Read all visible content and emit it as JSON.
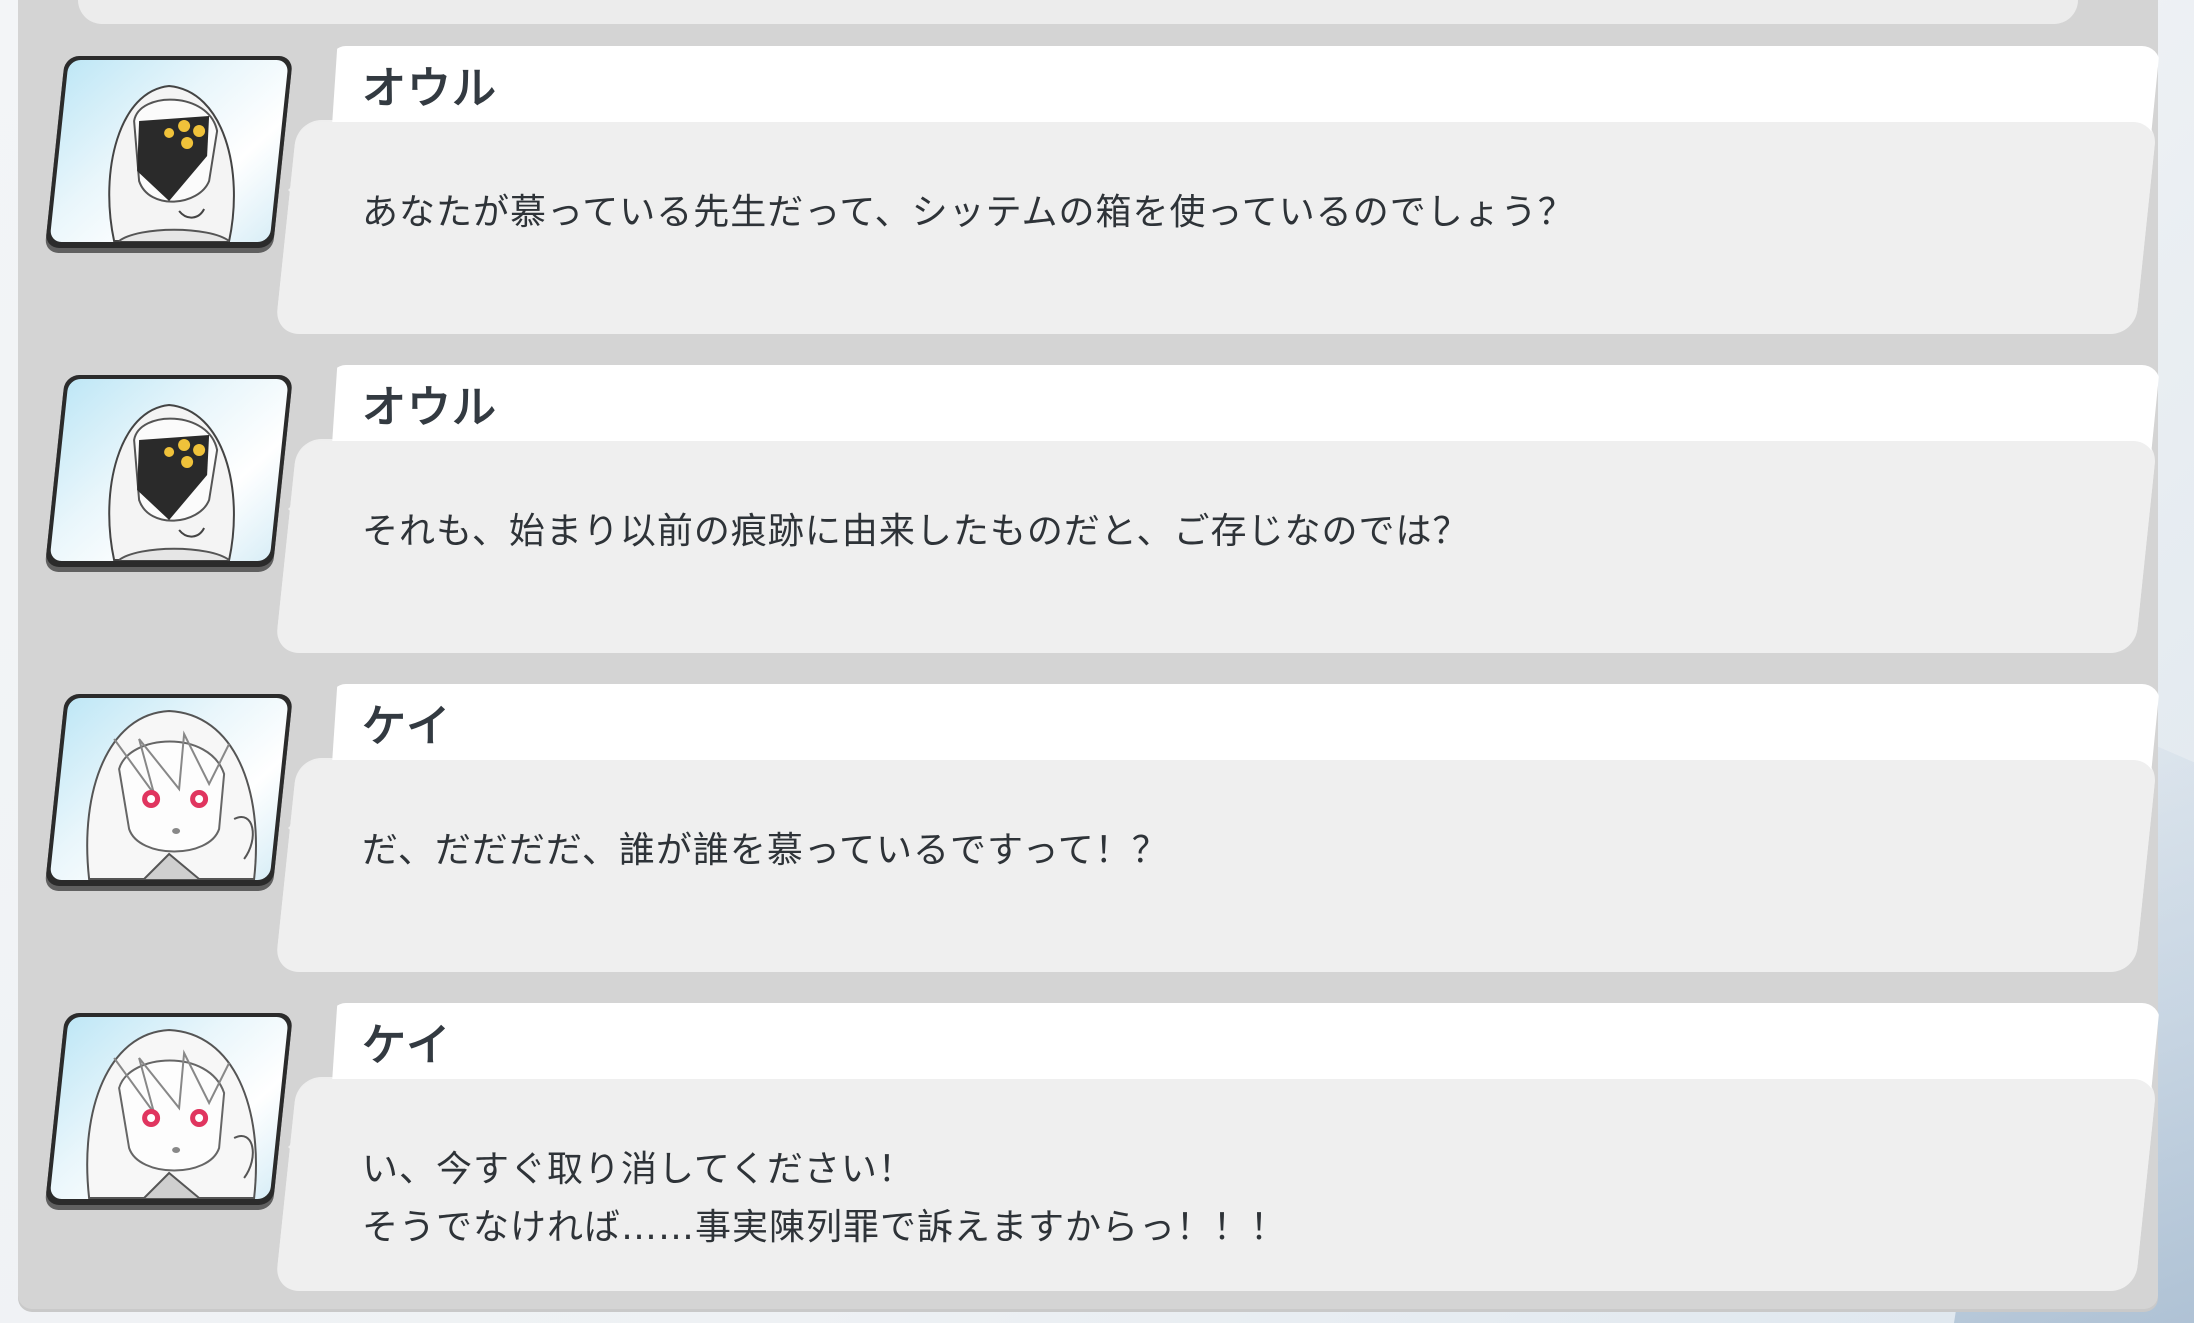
{
  "messages": [
    {
      "speaker": "オウル",
      "avatar": "owl-portrait-icon",
      "text": "あなたが慕っている先生だって、シッテムの箱を使っているのでしょう？"
    },
    {
      "speaker": "オウル",
      "avatar": "owl-portrait-icon",
      "text": "それも、始まり以前の痕跡に由来したものだと、ご存じなのでは？"
    },
    {
      "speaker": "ケイ",
      "avatar": "kei-portrait-icon",
      "text": "だ、だだだだ、誰が誰を慕っているですって！？"
    },
    {
      "speaker": "ケイ",
      "avatar": "kei-portrait-icon",
      "text": "い、今すぐ取り消してください！\nそうでなければ……事実陳列罪で訴えますからっ！！！"
    }
  ],
  "colors": {
    "panel": "#d4d4d4",
    "bubble": "#efefef",
    "name_tab": "#ffffff",
    "text": "#2e3338",
    "kei_eye": "#e0355f",
    "owl_eye": "#f0c23a"
  }
}
